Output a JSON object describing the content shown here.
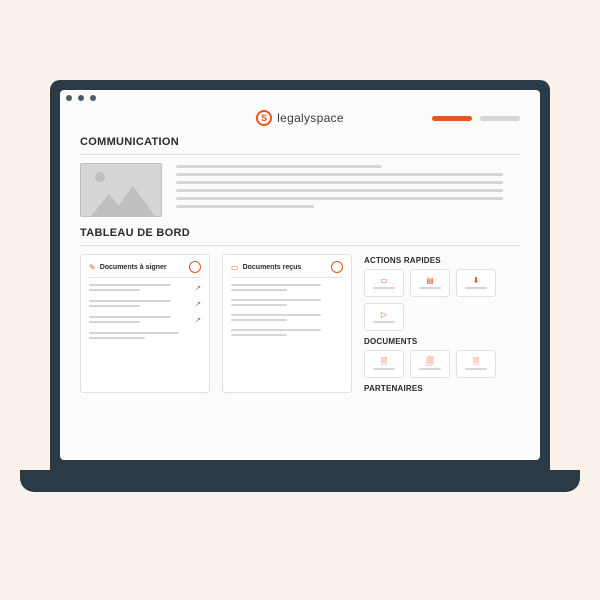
{
  "logo": {
    "text": "legalyspace",
    "glyph": "S"
  },
  "sections": {
    "communication": {
      "title": "COMMUNICATION"
    },
    "dashboard": {
      "title": "TABLEAU DE BORD"
    }
  },
  "cards": {
    "to_sign": {
      "title": "Documents à signer"
    },
    "received": {
      "title": "Documents reçus"
    }
  },
  "side": {
    "quick_actions": {
      "title": "ACTIONS RAPIDES"
    },
    "documents": {
      "title": "DOCUMENTS"
    },
    "partners": {
      "title": "PARTENAIRES"
    }
  },
  "colors": {
    "accent": "#e7551b"
  }
}
